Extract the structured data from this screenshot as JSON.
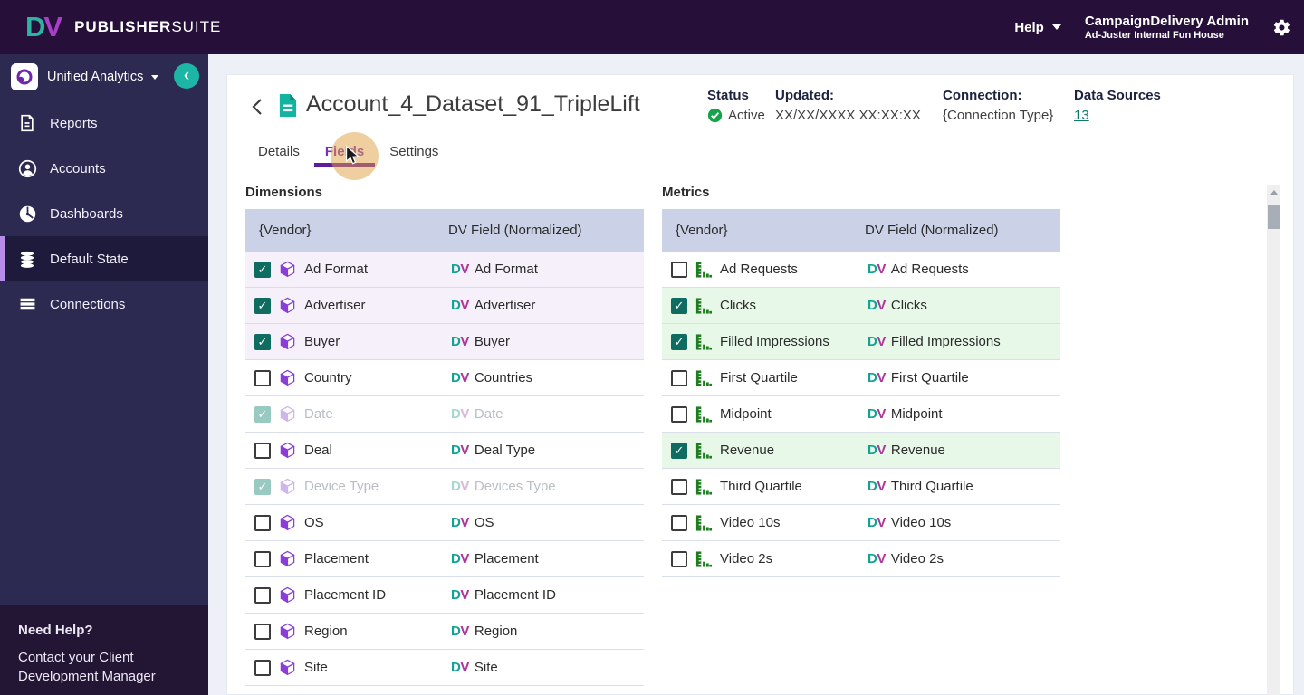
{
  "topnav": {
    "logo_d": "D",
    "logo_v": "V",
    "logo_publisher": "PUBLISHER",
    "logo_suite": "SUITE",
    "help_label": "Help",
    "user_name": "CampaignDelivery Admin",
    "user_org": "Ad-Juster Internal Fun House"
  },
  "sidebar": {
    "product_label": "Unified Analytics",
    "items": [
      {
        "label": "Reports",
        "icon": "reports-icon",
        "selected": false
      },
      {
        "label": "Accounts",
        "icon": "accounts-icon",
        "selected": false
      },
      {
        "label": "Dashboards",
        "icon": "dashboards-icon",
        "selected": false
      },
      {
        "label": "Default State",
        "icon": "database-icon",
        "selected": true
      },
      {
        "label": "Connections",
        "icon": "connections-icon",
        "selected": false
      }
    ],
    "help_title": "Need Help?",
    "help_text": "Contact your Client Development Manager"
  },
  "header": {
    "title": "Account_4_Dataset_91_TripleLift",
    "status_label": "Status",
    "status_value": "Active",
    "updated_label": "Updated:",
    "updated_value": "XX/XX/XXXX XX:XX:XX",
    "connection_label": "Connection:",
    "connection_value": "{Connection Type}",
    "data_sources_label": "Data Sources",
    "data_sources_value": "13"
  },
  "tabs": [
    {
      "label": "Details",
      "active": false
    },
    {
      "label": "Fields",
      "active": true
    },
    {
      "label": "Settings",
      "active": false
    }
  ],
  "dv_prefix": {
    "d": "D",
    "v": "V"
  },
  "dimensions": {
    "title": "Dimensions",
    "columns": [
      "{Vendor}",
      "DV Field (Normalized)"
    ],
    "rows": [
      {
        "vendor": "Ad Format",
        "dv": "Ad Format",
        "state": "checked"
      },
      {
        "vendor": "Advertiser",
        "dv": "Advertiser",
        "state": "checked"
      },
      {
        "vendor": "Buyer",
        "dv": "Buyer",
        "state": "checked"
      },
      {
        "vendor": "Country",
        "dv": "Countries",
        "state": "unchecked"
      },
      {
        "vendor": "Date",
        "dv": "Date",
        "state": "disabled"
      },
      {
        "vendor": "Deal",
        "dv": "Deal Type",
        "state": "unchecked"
      },
      {
        "vendor": "Device Type",
        "dv": "Devices Type",
        "state": "disabled"
      },
      {
        "vendor": "OS",
        "dv": "OS",
        "state": "unchecked"
      },
      {
        "vendor": "Placement",
        "dv": "Placement",
        "state": "unchecked"
      },
      {
        "vendor": "Placement ID",
        "dv": "Placement ID",
        "state": "unchecked"
      },
      {
        "vendor": "Region",
        "dv": "Region",
        "state": "unchecked"
      },
      {
        "vendor": "Site",
        "dv": "Site",
        "state": "unchecked"
      }
    ]
  },
  "metrics": {
    "title": "Metrics",
    "columns": [
      "{Vendor}",
      "DV Field (Normalized)"
    ],
    "rows": [
      {
        "vendor": "Ad Requests",
        "dv": "Ad Requests",
        "state": "unchecked"
      },
      {
        "vendor": "Clicks",
        "dv": "Clicks",
        "state": "checked"
      },
      {
        "vendor": "Filled Impressions",
        "dv": "Filled Impressions",
        "state": "checked"
      },
      {
        "vendor": "First Quartile",
        "dv": "First Quartile",
        "state": "unchecked"
      },
      {
        "vendor": "Midpoint",
        "dv": "Midpoint",
        "state": "unchecked"
      },
      {
        "vendor": "Revenue",
        "dv": "Revenue",
        "state": "checked"
      },
      {
        "vendor": "Third Quartile",
        "dv": "Third Quartile",
        "state": "unchecked"
      },
      {
        "vendor": "Video 10s",
        "dv": "Video 10s",
        "state": "unchecked"
      },
      {
        "vendor": "Video 2s",
        "dv": "Video 2s",
        "state": "unchecked"
      }
    ]
  },
  "colors": {
    "topnav_bg": "#26103a",
    "sidebar_bg": "#2d2a51",
    "accent_teal": "#1db5a5",
    "active_tab_purple": "#7b2ebf",
    "dimension_purple": "#8a3ed6",
    "metric_green": "#1d7d1f",
    "checked_teal": "#0f6c60",
    "status_green": "#17a34a",
    "dim_row_highlight": "#f6f0fa",
    "met_row_highlight": "#e7f8e8",
    "table_header_bg": "#cbd2e7"
  }
}
